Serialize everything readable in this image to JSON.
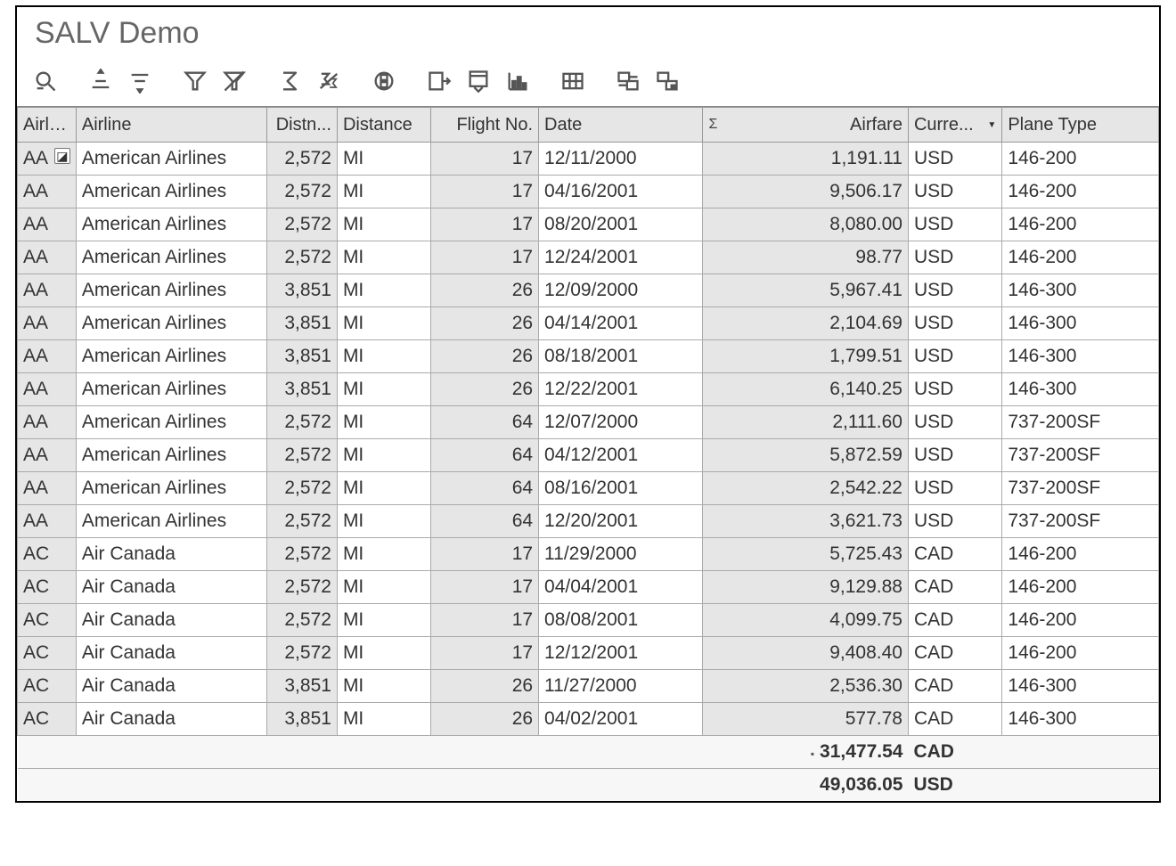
{
  "window": {
    "title": "SALV Demo"
  },
  "toolbar": {
    "icons": [
      "details-icon",
      "sort-asc-icon",
      "sort-desc-icon",
      "filter-icon",
      "filter-off-icon",
      "sum-icon",
      "subtotal-icon",
      "print-icon",
      "export-icon",
      "layout-icon",
      "chart-icon",
      "grid-icon",
      "settings-icon",
      "variant-icon"
    ]
  },
  "columns": [
    {
      "key": "code",
      "label": "Airline",
      "align": "left"
    },
    {
      "key": "name",
      "label": "Airline",
      "align": "left"
    },
    {
      "key": "dist",
      "label": "Distn...",
      "align": "right"
    },
    {
      "key": "unit",
      "label": "Distance",
      "align": "left"
    },
    {
      "key": "flight",
      "label": "Flight No.",
      "align": "right"
    },
    {
      "key": "date",
      "label": "Date",
      "align": "left"
    },
    {
      "key": "fare",
      "label": "Airfare",
      "align": "right",
      "sigma": "Σ"
    },
    {
      "key": "curr",
      "label": "Curre...",
      "align": "left",
      "dropdown": true
    },
    {
      "key": "plane",
      "label": "Plane Type",
      "align": "left"
    }
  ],
  "rows": [
    {
      "code": "AA",
      "name": "American Airlines",
      "dist": "2,572",
      "unit": "MI",
      "flight": "17",
      "date": "12/11/2000",
      "fare": "1,191.11",
      "curr": "USD",
      "plane": "146-200",
      "first": true
    },
    {
      "code": "AA",
      "name": "American Airlines",
      "dist": "2,572",
      "unit": "MI",
      "flight": "17",
      "date": "04/16/2001",
      "fare": "9,506.17",
      "curr": "USD",
      "plane": "146-200"
    },
    {
      "code": "AA",
      "name": "American Airlines",
      "dist": "2,572",
      "unit": "MI",
      "flight": "17",
      "date": "08/20/2001",
      "fare": "8,080.00",
      "curr": "USD",
      "plane": "146-200"
    },
    {
      "code": "AA",
      "name": "American Airlines",
      "dist": "2,572",
      "unit": "MI",
      "flight": "17",
      "date": "12/24/2001",
      "fare": "98.77",
      "curr": "USD",
      "plane": "146-200"
    },
    {
      "code": "AA",
      "name": "American Airlines",
      "dist": "3,851",
      "unit": "MI",
      "flight": "26",
      "date": "12/09/2000",
      "fare": "5,967.41",
      "curr": "USD",
      "plane": "146-300"
    },
    {
      "code": "AA",
      "name": "American Airlines",
      "dist": "3,851",
      "unit": "MI",
      "flight": "26",
      "date": "04/14/2001",
      "fare": "2,104.69",
      "curr": "USD",
      "plane": "146-300"
    },
    {
      "code": "AA",
      "name": "American Airlines",
      "dist": "3,851",
      "unit": "MI",
      "flight": "26",
      "date": "08/18/2001",
      "fare": "1,799.51",
      "curr": "USD",
      "plane": "146-300"
    },
    {
      "code": "AA",
      "name": "American Airlines",
      "dist": "3,851",
      "unit": "MI",
      "flight": "26",
      "date": "12/22/2001",
      "fare": "6,140.25",
      "curr": "USD",
      "plane": "146-300"
    },
    {
      "code": "AA",
      "name": "American Airlines",
      "dist": "2,572",
      "unit": "MI",
      "flight": "64",
      "date": "12/07/2000",
      "fare": "2,111.60",
      "curr": "USD",
      "plane": "737-200SF"
    },
    {
      "code": "AA",
      "name": "American Airlines",
      "dist": "2,572",
      "unit": "MI",
      "flight": "64",
      "date": "04/12/2001",
      "fare": "5,872.59",
      "curr": "USD",
      "plane": "737-200SF"
    },
    {
      "code": "AA",
      "name": "American Airlines",
      "dist": "2,572",
      "unit": "MI",
      "flight": "64",
      "date": "08/16/2001",
      "fare": "2,542.22",
      "curr": "USD",
      "plane": "737-200SF"
    },
    {
      "code": "AA",
      "name": "American Airlines",
      "dist": "2,572",
      "unit": "MI",
      "flight": "64",
      "date": "12/20/2001",
      "fare": "3,621.73",
      "curr": "USD",
      "plane": "737-200SF"
    },
    {
      "code": "AC",
      "name": "Air Canada",
      "dist": "2,572",
      "unit": "MI",
      "flight": "17",
      "date": "11/29/2000",
      "fare": "5,725.43",
      "curr": "CAD",
      "plane": "146-200"
    },
    {
      "code": "AC",
      "name": "Air Canada",
      "dist": "2,572",
      "unit": "MI",
      "flight": "17",
      "date": "04/04/2001",
      "fare": "9,129.88",
      "curr": "CAD",
      "plane": "146-200"
    },
    {
      "code": "AC",
      "name": "Air Canada",
      "dist": "2,572",
      "unit": "MI",
      "flight": "17",
      "date": "08/08/2001",
      "fare": "4,099.75",
      "curr": "CAD",
      "plane": "146-200"
    },
    {
      "code": "AC",
      "name": "Air Canada",
      "dist": "2,572",
      "unit": "MI",
      "flight": "17",
      "date": "12/12/2001",
      "fare": "9,408.40",
      "curr": "CAD",
      "plane": "146-200"
    },
    {
      "code": "AC",
      "name": "Air Canada",
      "dist": "3,851",
      "unit": "MI",
      "flight": "26",
      "date": "11/27/2000",
      "fare": "2,536.30",
      "curr": "CAD",
      "plane": "146-300"
    },
    {
      "code": "AC",
      "name": "Air Canada",
      "dist": "3,851",
      "unit": "MI",
      "flight": "26",
      "date": "04/02/2001",
      "fare": "577.78",
      "curr": "CAD",
      "plane": "146-300"
    }
  ],
  "totals": [
    {
      "amount": "31,477.54",
      "curr": "CAD",
      "bullet": "▪"
    },
    {
      "amount": "49,036.05",
      "curr": "USD",
      "bullet": ""
    }
  ]
}
